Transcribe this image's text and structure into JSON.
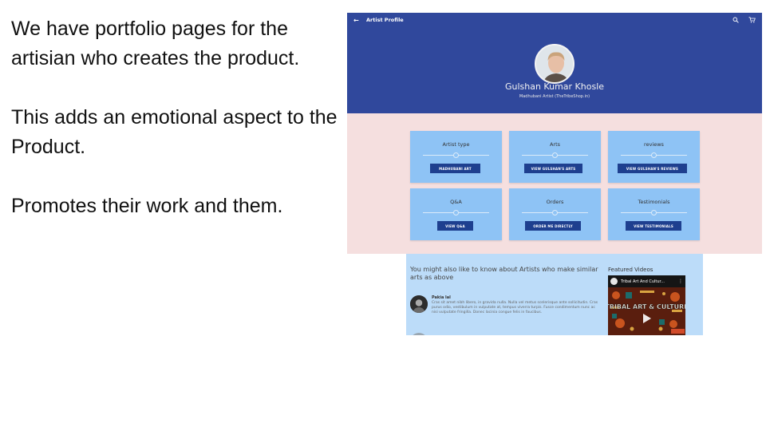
{
  "slide": {
    "paragraphs": [
      "We have portfolio pages for the artisian who creates the product.",
      "This adds an emotional aspect to the Product.",
      "Promotes their work and them."
    ]
  },
  "app": {
    "topbar": {
      "back_icon": "arrow-left-icon",
      "title": "Artist Profile",
      "icons": [
        "search-icon",
        "cart-icon"
      ]
    },
    "profile": {
      "name": "Gulshan Kumar Khosle",
      "subtitle": "Madhubani Artist (TheTribeShop.in)"
    },
    "cards": [
      {
        "title": "Artist type",
        "button": "MADHUBANI ART"
      },
      {
        "title": "Arts",
        "button": "VIEW GULSHAN'S ARTS"
      },
      {
        "title": "reviews",
        "button": "VIEW GULSHAN'S REVIEWS"
      },
      {
        "title": "Q&A",
        "button": "VIEW Q&A"
      },
      {
        "title": "Orders",
        "button": "ORDER ME DIRECTLY"
      },
      {
        "title": "Testimonials",
        "button": "VIEW TESTIMONIALS"
      }
    ],
    "related": {
      "heading": "You might also like to know about Artists who make similar arts as above",
      "artist": {
        "name": "Pakia lal",
        "bio": "Cras sit amet nibh libero, in gravida nulla. Nulla vel metus scelerisque ante sollicitudin. Cras purus odio, vestibulum in vulputate at, tempus viverra turpis. Fusce condimentum nunc ac nisi vulputate fringilla. Donec lacinia congue felis in faucibus."
      }
    },
    "featured": {
      "label": "Featured Videos",
      "video_title": "Tribal Art And Cultur...",
      "thumbnail_text": "TRIBAL ART & CULTURE"
    }
  },
  "colors": {
    "header_blue": "#30489c",
    "body_pink": "#f5dfdf",
    "card_blue": "#8ec3f5",
    "button_navy": "#1e3f8f",
    "lower_blue": "#bcdcf9"
  }
}
